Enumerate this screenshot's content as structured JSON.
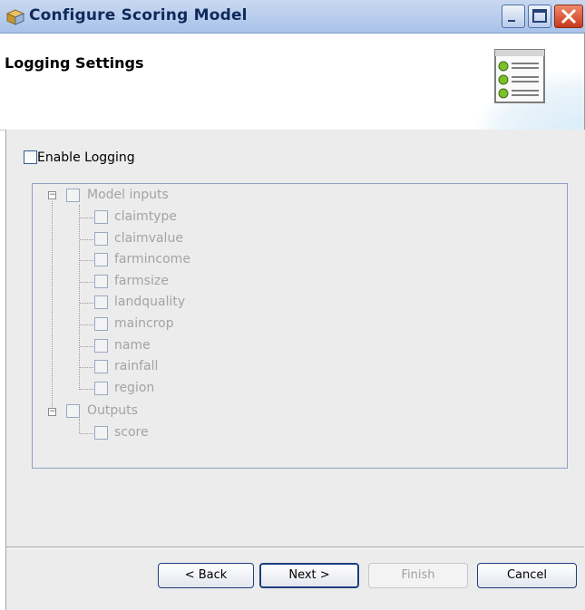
{
  "window": {
    "title": "Configure Scoring Model"
  },
  "header": {
    "title": "Logging Settings"
  },
  "logging": {
    "enable_label": "Enable Logging"
  },
  "tree": {
    "inputs": {
      "label": "Model inputs",
      "items": [
        "claimtype",
        "claimvalue",
        "farmincome",
        "farmsize",
        "landquality",
        "maincrop",
        "name",
        "rainfall",
        "region"
      ]
    },
    "outputs": {
      "label": "Outputs",
      "items": [
        "score"
      ]
    }
  },
  "buttons": {
    "back": "< Back",
    "next": "Next >",
    "finish": "Finish",
    "cancel": "Cancel"
  },
  "colors": {
    "disabled_text": "#a3a3a3",
    "title_bar": "#a9c2ea",
    "close_button": "#c7391c",
    "panel": "#ececec"
  }
}
